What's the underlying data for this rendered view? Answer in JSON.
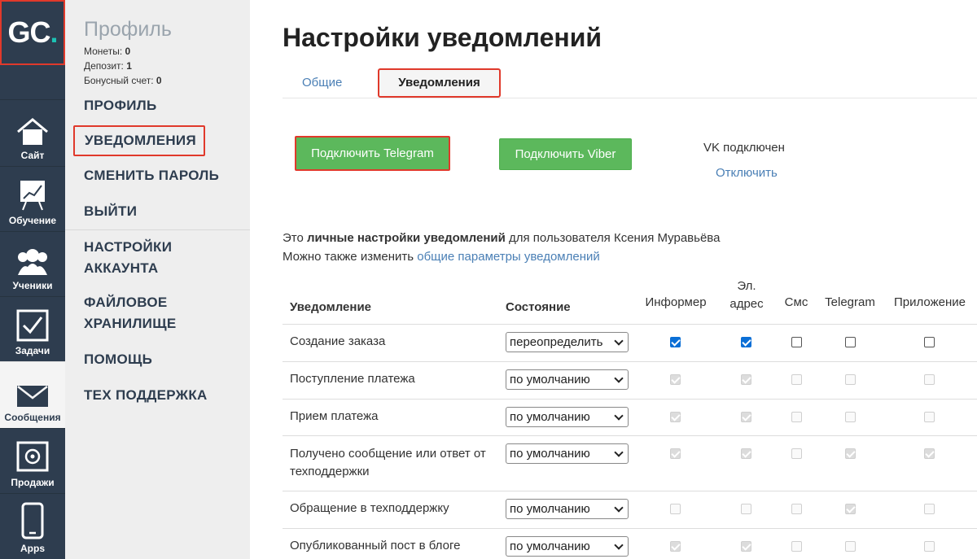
{
  "logo": {
    "text": "GC",
    "dot": "."
  },
  "rail": [
    {
      "label": "Сайт",
      "icon": "home-icon"
    },
    {
      "label": "Обучение",
      "icon": "chart-board-icon"
    },
    {
      "label": "Ученики",
      "icon": "users-icon"
    },
    {
      "label": "Задачи",
      "icon": "checkbox-icon"
    },
    {
      "label": "Сообщения",
      "icon": "envelope-icon"
    },
    {
      "label": "Продажи",
      "icon": "safe-icon"
    },
    {
      "label": "Apps",
      "icon": "phone-icon"
    }
  ],
  "profile": {
    "title": "Профиль",
    "coins_label": "Монеты:",
    "coins_value": "0",
    "deposit_label": "Депозит:",
    "deposit_value": "1",
    "bonus_label": "Бонусный счет:",
    "bonus_value": "0",
    "menu": [
      "ПРОФИЛЬ",
      "УВЕДОМЛЕНИЯ",
      "СМЕНИТЬ ПАРОЛЬ",
      "ВЫЙТИ",
      "НАСТРОЙКИ",
      "АККАУНТА",
      "ФАЙЛОВОЕ",
      "ХРАНИЛИЩЕ",
      "ПОМОЩЬ",
      "ТЕХ ПОДДЕРЖКА"
    ]
  },
  "page": {
    "title": "Настройки уведомлений",
    "tabs": [
      "Общие",
      "Уведомления"
    ],
    "btn_telegram": "Подключить Telegram",
    "btn_viber": "Подключить Viber",
    "vk_status": "VK подключен",
    "vk_disconnect": "Отключить",
    "info1_pre": "Это ",
    "info1_bold": "личные настройки уведомлений",
    "info1_post": " для пользователя Ксения Муравьёва",
    "info2_pre": "Можно также изменить ",
    "info2_link": "общие параметры уведомлений"
  },
  "table": {
    "headers": {
      "notification": "Уведомление",
      "state": "Состояние",
      "informer": "Информер",
      "email_1": "Эл.",
      "email_2": "адрес",
      "sms": "Смс",
      "telegram": "Telegram",
      "app": "Приложение"
    },
    "rows": [
      {
        "name": "Создание заказа",
        "state": "переопределить",
        "checks": [
          "on",
          "on",
          "off",
          "off",
          "off"
        ]
      },
      {
        "name": "Поступление платежа",
        "state": "по умолчанию",
        "checks": [
          "dis-on",
          "dis-on",
          "dis-off",
          "dis-off",
          "dis-off"
        ]
      },
      {
        "name": "Прием платежа",
        "state": "по умолчанию",
        "checks": [
          "dis-on",
          "dis-on",
          "dis-off",
          "dis-off",
          "dis-off"
        ]
      },
      {
        "name": "Получено сообщение или ответ от техподдержки",
        "state": "по умолчанию",
        "checks": [
          "dis-on",
          "dis-on",
          "dis-off",
          "dis-on",
          "dis-on"
        ]
      },
      {
        "name": "Обращение в техподдержку",
        "state": "по умолчанию",
        "checks": [
          "dis-off",
          "dis-off",
          "dis-off",
          "dis-on",
          "dis-off"
        ]
      },
      {
        "name": "Опубликованный пост в блоге",
        "state": "по умолчанию",
        "checks": [
          "dis-on",
          "dis-on",
          "dis-off",
          "dis-off",
          "dis-off"
        ]
      }
    ]
  }
}
